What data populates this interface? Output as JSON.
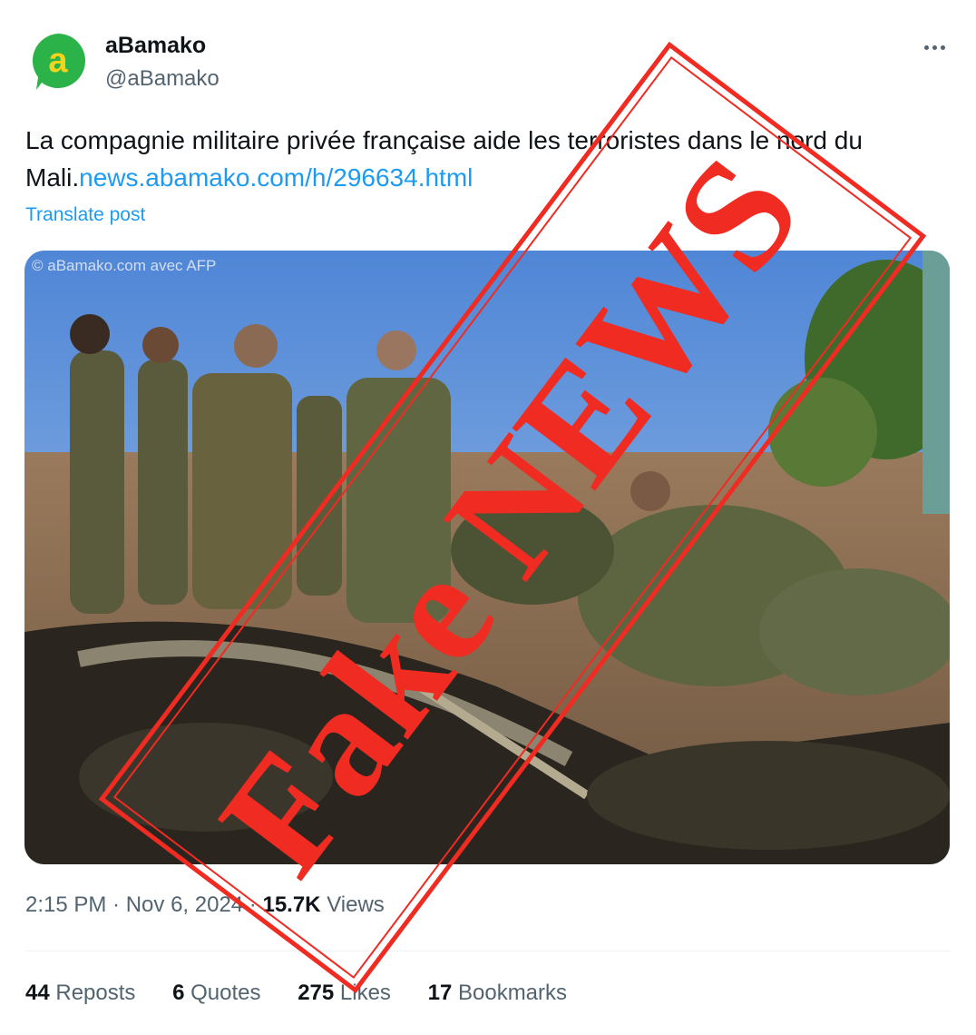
{
  "account": {
    "name": "aBamako",
    "handle": "@aBamako",
    "avatar_letter": "a",
    "avatar_color": "#2bb34a",
    "avatar_accent": "#f5d21b"
  },
  "post": {
    "text": "La compagnie militaire privée française aide les terroristes dans le nord du Mali.",
    "link": "news.abamako.com/h/296634.html",
    "translate": "Translate post"
  },
  "media": {
    "watermark": "© aBamako.com avec AFP",
    "stamp_text": "Fake NEWS",
    "stamp_color": "#ef2b22"
  },
  "meta": {
    "time": "2:15 PM",
    "date": "Nov 6, 2024",
    "views_count": "15.7K",
    "views_label": "Views"
  },
  "stats": {
    "reposts_count": "44",
    "reposts_label": "Reposts",
    "quotes_count": "6",
    "quotes_label": "Quotes",
    "likes_count": "275",
    "likes_label": "Likes",
    "bookmarks_count": "17",
    "bookmarks_label": "Bookmarks"
  },
  "icons": [
    "more-icon",
    "avatar-logo"
  ]
}
